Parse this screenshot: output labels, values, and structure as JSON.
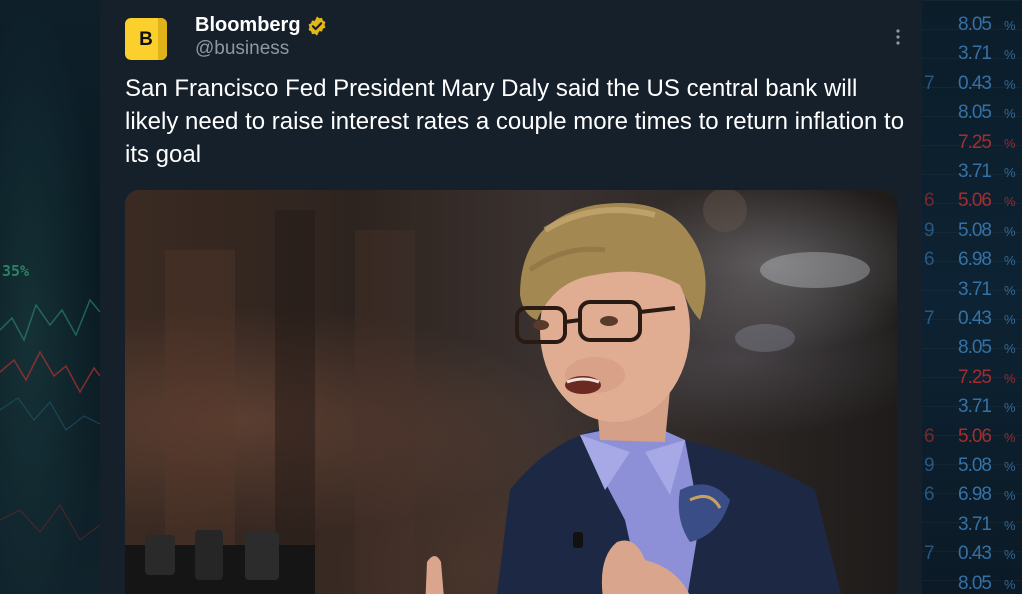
{
  "background": {
    "left_chart_label": "35%",
    "ticker_rows": [
      {
        "lead": "",
        "value": "8.05",
        "sym": "%",
        "color": "blue"
      },
      {
        "lead": "",
        "value": "3.71",
        "sym": "%",
        "color": "blue"
      },
      {
        "lead": "7",
        "value": "0.43",
        "sym": "%",
        "color": "blue"
      },
      {
        "lead": "",
        "value": "8.05",
        "sym": "%",
        "color": "blue"
      },
      {
        "lead": "",
        "value": "7.25",
        "sym": "%",
        "color": "red"
      },
      {
        "lead": "",
        "value": "3.71",
        "sym": "%",
        "color": "blue"
      },
      {
        "lead": "6",
        "value": "5.06",
        "sym": "%",
        "color": "red"
      },
      {
        "lead": "9",
        "value": "5.08",
        "sym": "%",
        "color": "blue"
      },
      {
        "lead": "6",
        "value": "6.98",
        "sym": "%",
        "color": "blue"
      },
      {
        "lead": "",
        "value": "3.71",
        "sym": "%",
        "color": "blue"
      },
      {
        "lead": "7",
        "value": "0.43",
        "sym": "%",
        "color": "blue"
      },
      {
        "lead": "",
        "value": "8.05",
        "sym": "%",
        "color": "blue"
      },
      {
        "lead": "",
        "value": "7.25",
        "sym": "%",
        "color": "red"
      },
      {
        "lead": "",
        "value": "3.71",
        "sym": "%",
        "color": "blue"
      },
      {
        "lead": "6",
        "value": "5.06",
        "sym": "%",
        "color": "red"
      },
      {
        "lead": "9",
        "value": "5.08",
        "sym": "%",
        "color": "blue"
      },
      {
        "lead": "6",
        "value": "6.98",
        "sym": "%",
        "color": "blue"
      },
      {
        "lead": "",
        "value": "3.71",
        "sym": "%",
        "color": "blue"
      },
      {
        "lead": "7",
        "value": "0.43",
        "sym": "%",
        "color": "blue"
      },
      {
        "lead": "",
        "value": "8.05",
        "sym": "%",
        "color": "blue"
      }
    ]
  },
  "tweet": {
    "avatar_letter": "B",
    "author_name": "Bloomberg",
    "handle": "@business",
    "verified_icon": "verified-badge-icon",
    "more_icon": "more-options-icon",
    "text": "San Francisco Fed President Mary Daly said the US central bank will likely need to raise interest rates a couple more times to return inflation to its goal",
    "media": {
      "type": "photo"
    }
  },
  "colors": {
    "card_bg": "#15202b",
    "text_primary": "#ffffff",
    "text_secondary": "#8b98a5",
    "avatar_yellow": "#fbd02c",
    "verified_gold": "#e2b719"
  }
}
